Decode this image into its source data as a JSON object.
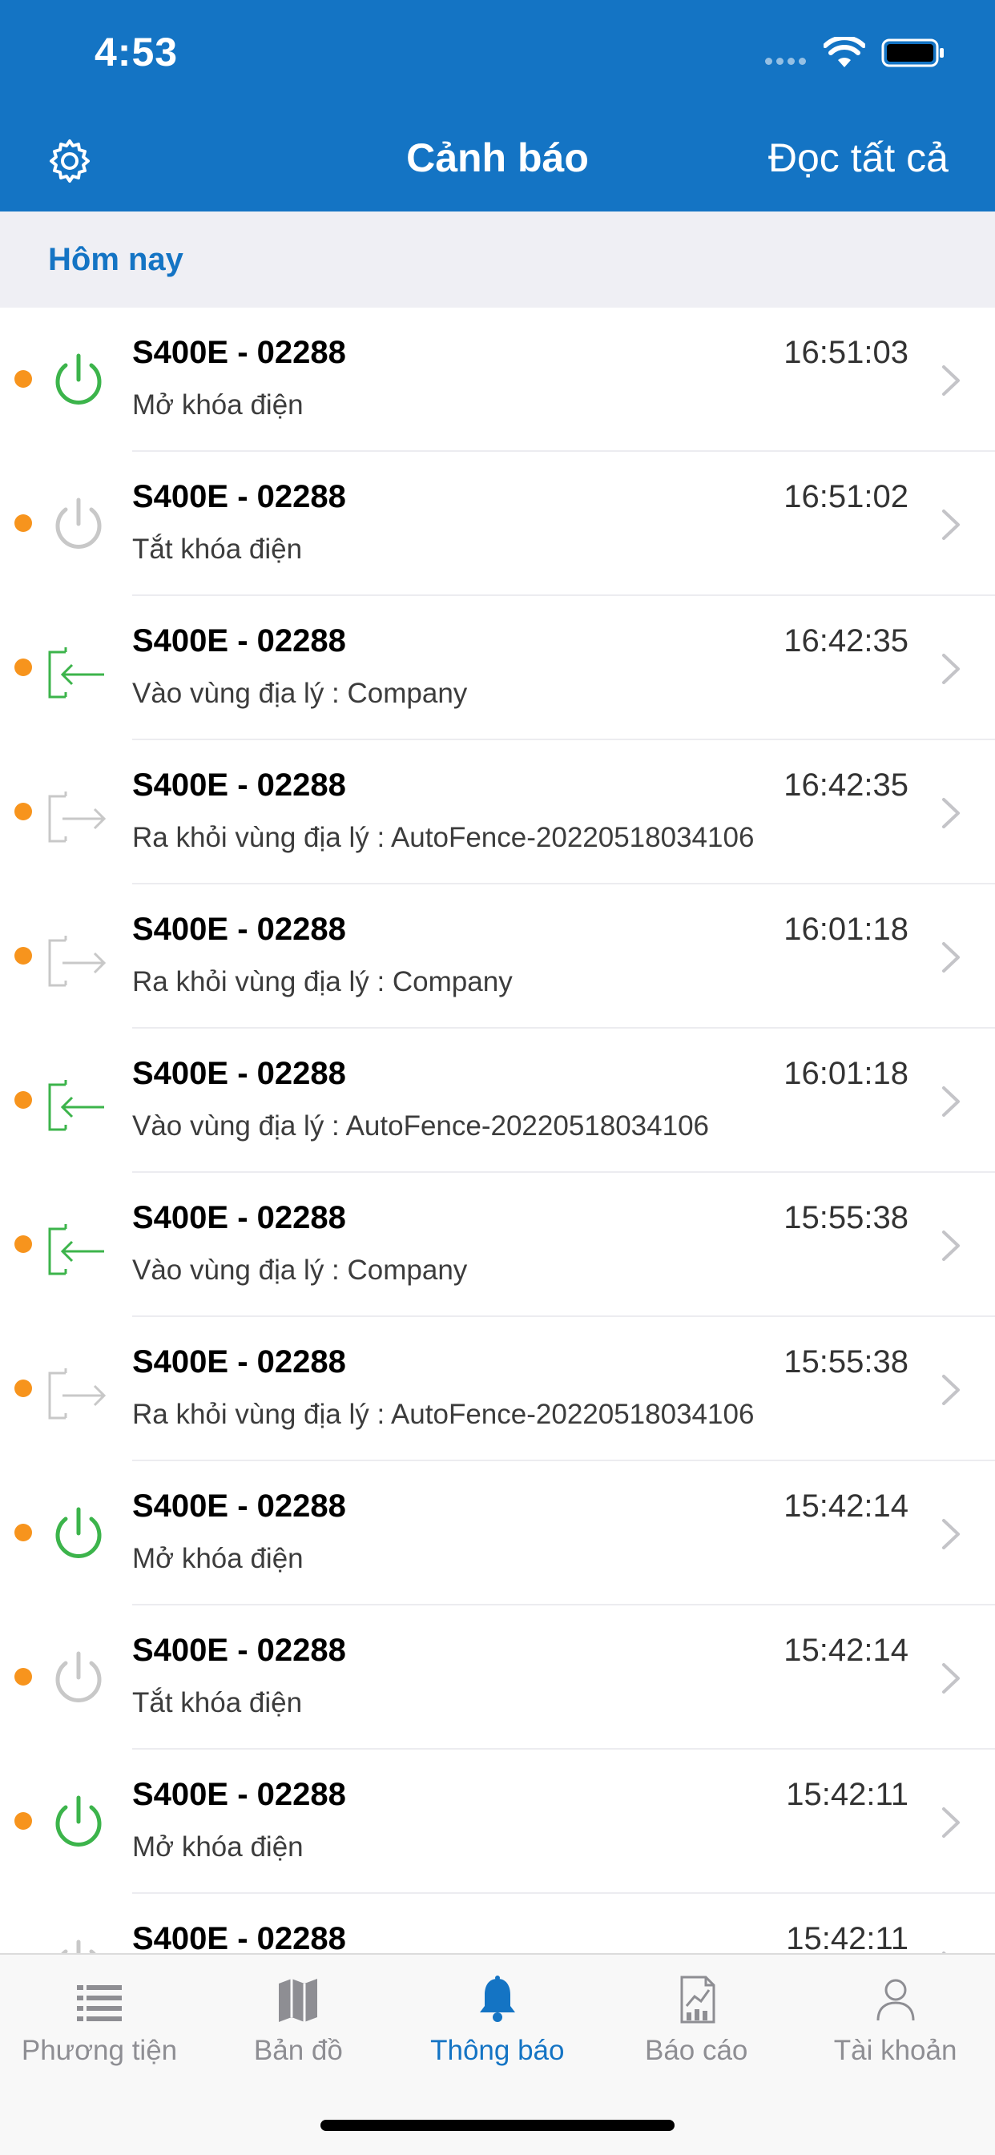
{
  "status_bar": {
    "time": "4:53"
  },
  "header": {
    "title": "Cảnh báo",
    "read_all": "Đọc tất cả"
  },
  "section": {
    "label": "Hôm nay"
  },
  "colors": {
    "accent": "#1474c4",
    "unread_dot": "#f7941d",
    "power_on": "#3cb44b",
    "geo_enter": "#3cb44b",
    "inactive": "#c8c8c8"
  },
  "alerts": [
    {
      "name": "S400E - 02288",
      "time": "16:51:03",
      "desc": "Mở khóa điện",
      "icon": "power-on-icon"
    },
    {
      "name": "S400E - 02288",
      "time": "16:51:02",
      "desc": "Tắt khóa điện",
      "icon": "power-off-icon"
    },
    {
      "name": "S400E - 02288",
      "time": "16:42:35",
      "desc": "Vào vùng địa lý : Company",
      "icon": "geofence-enter-icon"
    },
    {
      "name": "S400E - 02288",
      "time": "16:42:35",
      "desc": "Ra khỏi vùng địa lý : AutoFence-20220518034106",
      "icon": "geofence-exit-icon"
    },
    {
      "name": "S400E - 02288",
      "time": "16:01:18",
      "desc": "Ra khỏi vùng địa lý : Company",
      "icon": "geofence-exit-icon"
    },
    {
      "name": "S400E - 02288",
      "time": "16:01:18",
      "desc": "Vào vùng địa lý : AutoFence-20220518034106",
      "icon": "geofence-enter-icon"
    },
    {
      "name": "S400E - 02288",
      "time": "15:55:38",
      "desc": "Vào vùng địa lý : Company",
      "icon": "geofence-enter-icon"
    },
    {
      "name": "S400E - 02288",
      "time": "15:55:38",
      "desc": "Ra khỏi vùng địa lý : AutoFence-20220518034106",
      "icon": "geofence-exit-icon"
    },
    {
      "name": "S400E - 02288",
      "time": "15:42:14",
      "desc": "Mở khóa điện",
      "icon": "power-on-icon"
    },
    {
      "name": "S400E - 02288",
      "time": "15:42:14",
      "desc": "Tắt khóa điện",
      "icon": "power-off-icon"
    },
    {
      "name": "S400E - 02288",
      "time": "15:42:11",
      "desc": "Mở khóa điện",
      "icon": "power-on-icon"
    },
    {
      "name": "S400E - 02288",
      "time": "15:42:11",
      "desc": "",
      "icon": "power-off-icon"
    }
  ],
  "tabs": [
    {
      "label": "Phương tiện",
      "icon": "list-icon",
      "active": false
    },
    {
      "label": "Bản đồ",
      "icon": "map-icon",
      "active": false
    },
    {
      "label": "Thông báo",
      "icon": "bell-icon",
      "active": true
    },
    {
      "label": "Báo cáo",
      "icon": "report-icon",
      "active": false
    },
    {
      "label": "Tài khoản",
      "icon": "account-icon",
      "active": false
    }
  ]
}
